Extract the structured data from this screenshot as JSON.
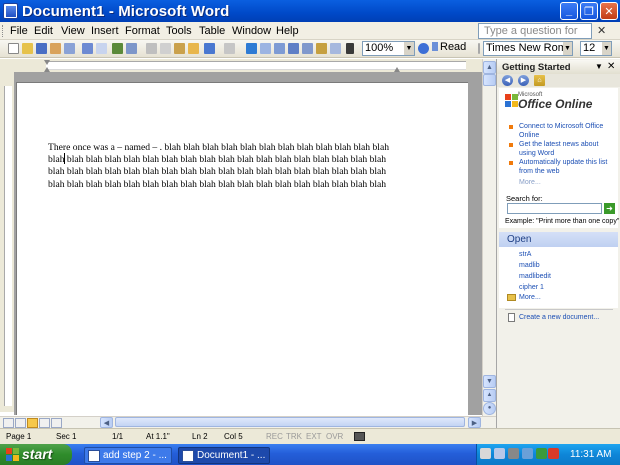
{
  "window": {
    "title": "Document1 - Microsoft Word",
    "minimize": "_",
    "restore": "❐",
    "close": "✕"
  },
  "menu": {
    "items": [
      "File",
      "Edit",
      "View",
      "Insert",
      "Format",
      "Tools",
      "Table",
      "Window",
      "Help"
    ],
    "ask_placeholder": "Type a question for help",
    "close": "✕"
  },
  "toolbar": {
    "zoom": "100%",
    "read": "Read",
    "font": "Times New Roman",
    "size": "12"
  },
  "document": {
    "text": "There once was a – named – . blah blah blah blah blah blah blah blah blah blah blah blah\nblah blah blah blah blah blah blah blah blah blah blah blah blah blah blah blah blah blah\nblah blah blah blah blah blah blah blah blah blah blah blah blah blah blah blah blah blah\nblah blah blah blah blah blah blah blah blah blah blah blah blah blah blah blah blah blah"
  },
  "taskpane": {
    "title": "Getting Started",
    "logo_small": "Microsoft",
    "logo_big": "Office Online",
    "links": [
      "Connect to Microsoft Office Online",
      "Get the latest news about using Word",
      "Automatically update this list from the web"
    ],
    "more": "More...",
    "search_label": "Search for:",
    "example": "Example: \"Print more than one copy\"",
    "open_header": "Open",
    "open_files": [
      "strA",
      "madlib",
      "madlibedit",
      "cipher 1"
    ],
    "open_more": "More...",
    "create_new": "Create a new document..."
  },
  "status": {
    "page": "Page 1",
    "sec": "Sec 1",
    "pages": "1/1",
    "at": "At 1.1\"",
    "ln": "Ln 2",
    "col": "Col 5",
    "rec": "REC",
    "trk": "TRK",
    "ext": "EXT",
    "ovr": "OVR"
  },
  "taskbar": {
    "start": "start",
    "tasks": [
      "add step 2 - ...",
      "Document1 - ..."
    ],
    "clock": "11:31 AM"
  },
  "colors": {
    "titlebar": "#0049c8",
    "pane_header": "#bfd0f1",
    "link": "#1c4fb4",
    "start": "#2f8c2b"
  }
}
